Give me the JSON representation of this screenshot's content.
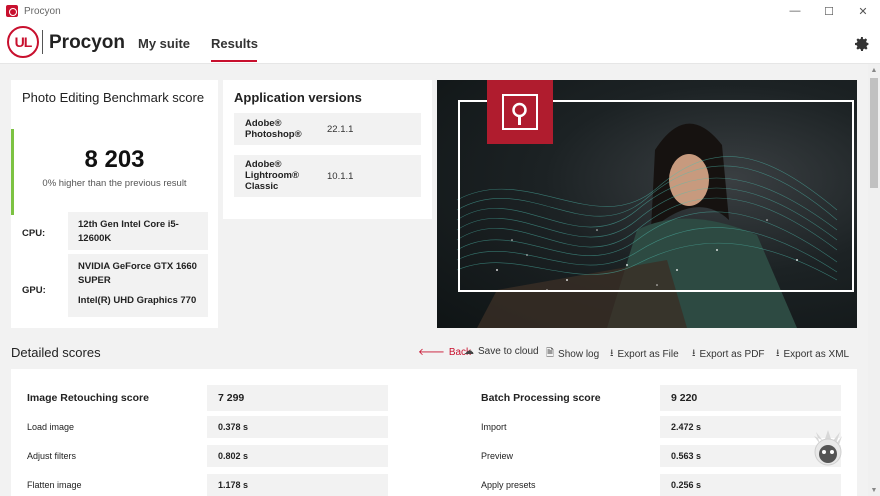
{
  "window": {
    "title": "Procyon",
    "minimize": "—",
    "maximize": "☐",
    "close": "✕"
  },
  "header": {
    "logo_text": "UL",
    "brand": "Procyon",
    "tabs": [
      {
        "label": "My suite"
      },
      {
        "label": "Results",
        "active": true
      }
    ],
    "settings_icon": "gear-icon"
  },
  "score_card": {
    "title": "Photo Editing Benchmark score",
    "score": "8 203",
    "comparison": "0% higher than the previous result",
    "cpu_label": "CPU:",
    "cpu_value": "12th Gen Intel Core i5-12600K",
    "gpu_label": "GPU:",
    "gpu_values": [
      "NVIDIA GeForce GTX 1660 SUPER",
      "Intel(R) UHD Graphics 770"
    ]
  },
  "app_versions": {
    "title": "Application versions",
    "apps": [
      {
        "name_lines": [
          "Adobe®",
          "Photoshop®"
        ],
        "version": "22.1.1"
      },
      {
        "name_lines": [
          "Adobe®",
          "Lightroom®",
          "Classic"
        ],
        "version": "10.1.1"
      }
    ]
  },
  "detailed": {
    "title": "Detailed scores",
    "actions": [
      {
        "label": "Back",
        "icon": "back-arrow-icon"
      },
      {
        "label": "Save to cloud",
        "icon": "cloud-upload-icon"
      },
      {
        "label": "Show log",
        "icon": "document-icon"
      },
      {
        "label": "Export as File",
        "icon": "download-icon"
      },
      {
        "label": "Export as PDF",
        "icon": "download-icon"
      },
      {
        "label": "Export as XML",
        "icon": "download-icon"
      }
    ],
    "left": {
      "title": "Image Retouching score",
      "score": "7 299",
      "rows": [
        {
          "label": "Load image",
          "value": "0.378 s"
        },
        {
          "label": "Adjust filters",
          "value": "0.802 s"
        },
        {
          "label": "Flatten image",
          "value": "1.178 s"
        }
      ]
    },
    "right": {
      "title": "Batch Processing score",
      "score": "9 220",
      "rows": [
        {
          "label": "Import",
          "value": "2.472 s"
        },
        {
          "label": "Preview",
          "value": "0.563 s"
        },
        {
          "label": "Apply presets",
          "value": "0.256 s"
        }
      ]
    }
  },
  "colors": {
    "accent": "#c8102e",
    "score_bar": "#7cc242",
    "badge": "#b01c2e"
  }
}
